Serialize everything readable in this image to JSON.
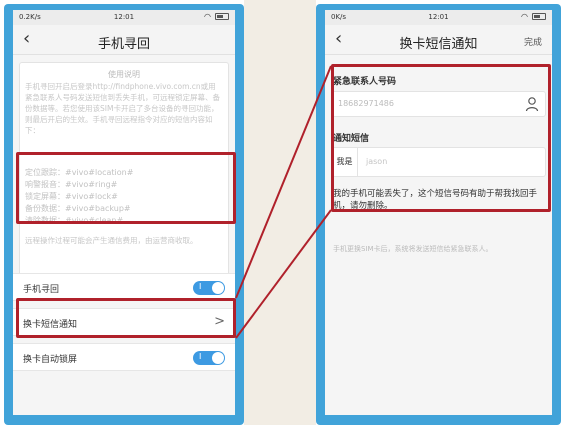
{
  "colors": {
    "frame_blue": "#41a3d9",
    "highlight_red": "#b0212b",
    "toggle_blue": "#3d9ae2"
  },
  "left_screen": {
    "status": {
      "carrier": "0.2K/s",
      "time": "12:01"
    },
    "title": "手机寻回",
    "description": {
      "title": "使用说明",
      "body": "手机寻回开启后登录http://findphone.vivo.com.cn或用紧急联系人号码发送短信到丢失手机，可远程锁定屏幕、备份数据等。若您使用该SIM卡开启了多台设备的寻回功能，则最后开启的生效。手机寻回远程指令对应的短信内容如下：",
      "commands": [
        "定位跟踪：#vivo#location#",
        "响警报音：#vivo#ring#",
        "锁定屏幕：#vivo#lock#",
        "备份数据：#vivo#backup#",
        "清除数据：#vivo#clean#"
      ],
      "note": "远程操作过程可能会产生通信费用，由运营商收取。"
    },
    "settings": [
      {
        "label": "手机寻回",
        "toggle_on": true,
        "toggle_mark": "I"
      },
      {
        "label": "换卡短信通知",
        "chevron": ">"
      },
      {
        "label": "换卡自动锁屏",
        "toggle_on": true,
        "toggle_mark": "I"
      }
    ]
  },
  "right_screen": {
    "status": {
      "carrier": "0K/s",
      "time": "12:01"
    },
    "title": "换卡短信通知",
    "done_label": "完成",
    "contact_label": "紧急联系人号码",
    "contact_number": "18682971486",
    "sms_label": "通知短信",
    "sms_prefix": "我是",
    "sms_name": "jason",
    "sms_hint": "我的手机可能丢失了，这个短信号码有助于帮我找回手机，请勿删除。",
    "footer_note": "手机更换SIM卡后，系统将发送短信给紧急联系人。"
  }
}
